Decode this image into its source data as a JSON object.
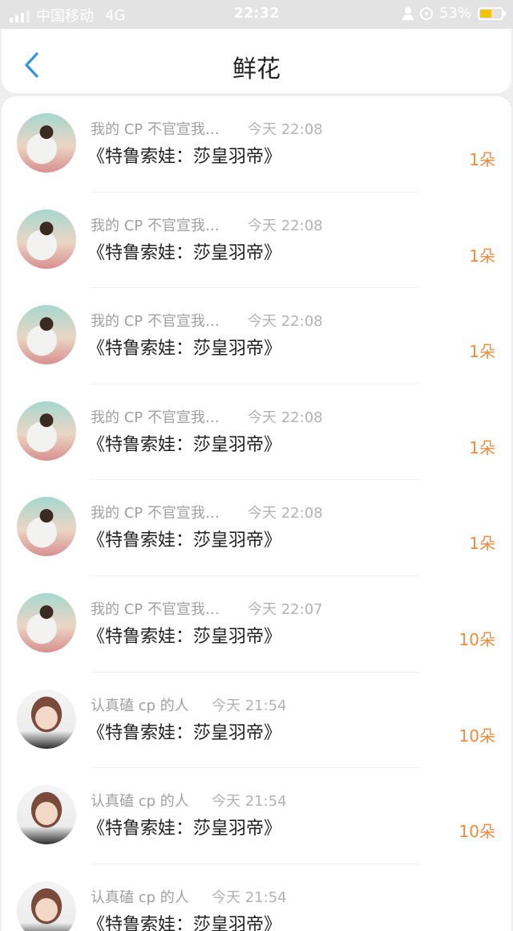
{
  "status_bar": {
    "carrier": "中国移动",
    "network": "4G",
    "time": "22:32",
    "battery_text": "53%",
    "battery_level": 0.53,
    "battery_color": "#f5c400"
  },
  "header": {
    "back_icon": "chevron-left-icon",
    "title": "鲜花"
  },
  "list": [
    {
      "user": "我的 CP 不官宣我…",
      "time": "今天 22:08",
      "work": "《特鲁索娃：莎皇羽帝》",
      "count": "1朵",
      "avatar": "avatar-plush"
    },
    {
      "user": "我的 CP 不官宣我…",
      "time": "今天 22:08",
      "work": "《特鲁索娃：莎皇羽帝》",
      "count": "1朵",
      "avatar": "avatar-plush"
    },
    {
      "user": "我的 CP 不官宣我…",
      "time": "今天 22:08",
      "work": "《特鲁索娃：莎皇羽帝》",
      "count": "1朵",
      "avatar": "avatar-plush"
    },
    {
      "user": "我的 CP 不官宣我…",
      "time": "今天 22:08",
      "work": "《特鲁索娃：莎皇羽帝》",
      "count": "1朵",
      "avatar": "avatar-plush"
    },
    {
      "user": "我的 CP 不官宣我…",
      "time": "今天 22:08",
      "work": "《特鲁索娃：莎皇羽帝》",
      "count": "1朵",
      "avatar": "avatar-plush"
    },
    {
      "user": "我的 CP 不官宣我…",
      "time": "今天 22:07",
      "work": "《特鲁索娃：莎皇羽帝》",
      "count": "10朵",
      "avatar": "avatar-plush"
    },
    {
      "user": "认真磕 cp 的人",
      "time": "今天 21:54",
      "work": "《特鲁索娃：莎皇羽帝》",
      "count": "10朵",
      "avatar": "avatar-girl"
    },
    {
      "user": "认真磕 cp 的人",
      "time": "今天 21:54",
      "work": "《特鲁索娃：莎皇羽帝》",
      "count": "10朵",
      "avatar": "avatar-girl"
    },
    {
      "user": "认真磕 cp 的人",
      "time": "今天 21:54",
      "work": "《特鲁索娃：莎皇羽帝》",
      "count": "",
      "avatar": "avatar-girl"
    }
  ],
  "colors": {
    "accent_blue": "#2f95e0",
    "count_orange": "#ef8a3c"
  }
}
